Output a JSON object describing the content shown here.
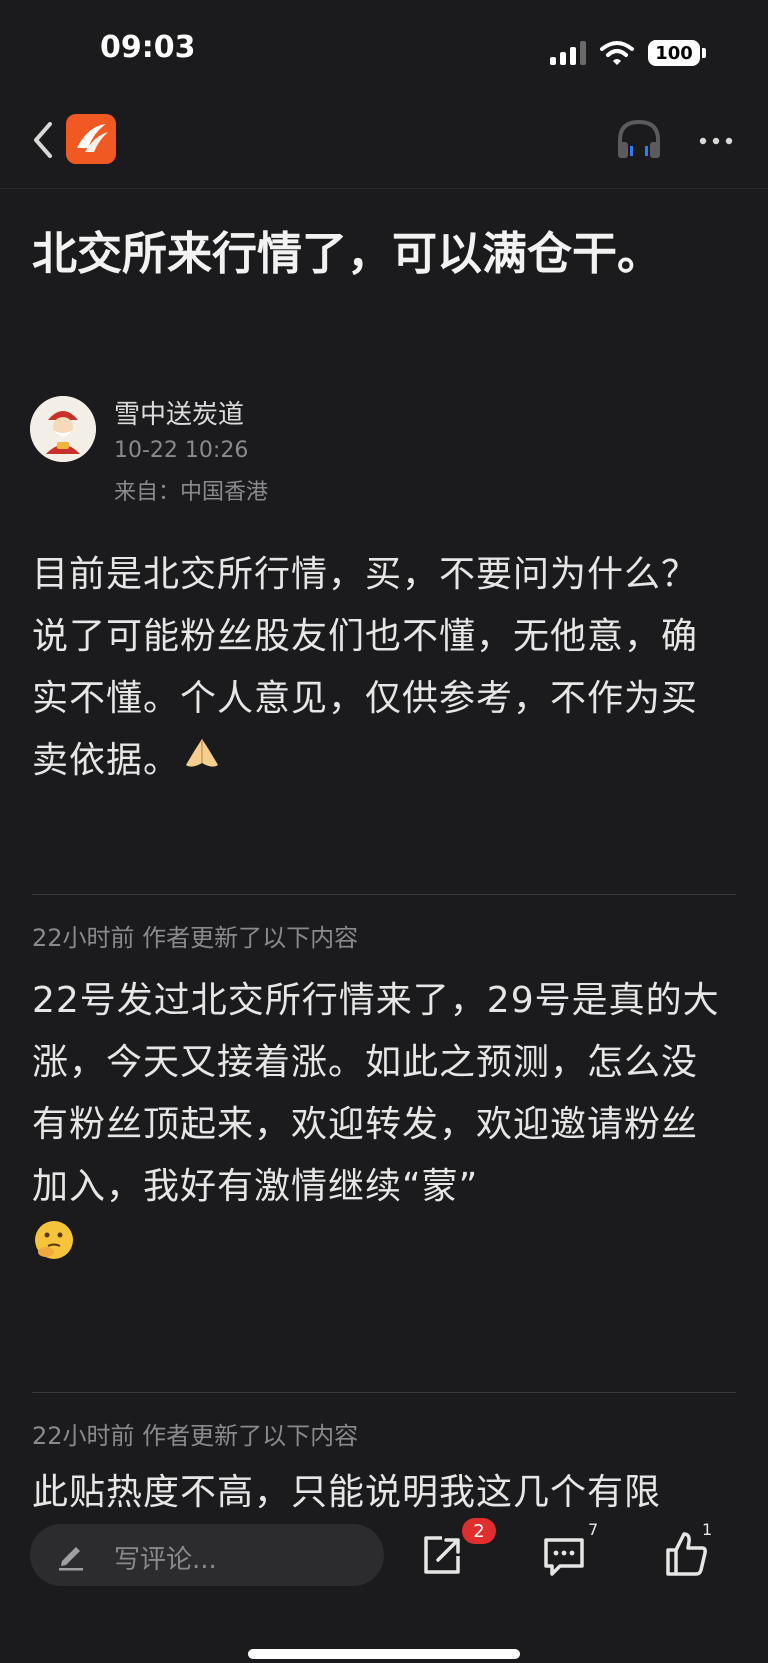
{
  "status_bar": {
    "time": "09:03",
    "battery": "100"
  },
  "nav": {
    "back_icon": "chevron-left-icon",
    "logo_icon": "app-logo-icon",
    "audio_icon": "headphone-icon",
    "more_icon": "more-dots-icon"
  },
  "post": {
    "title": "北交所来行情了，可以满仓干。",
    "author": "雪中送炭道",
    "time": "10-22 10:26",
    "origin": "来自：中国香港",
    "paragraph1": "目前是北交所行情，买，不要问为什么？说了可能粉丝股友们也不懂，无他意，确实不懂。个人意见，仅供参考，不作为买卖依据。",
    "emoji1": "pray-icon",
    "update1_label": "22小时前 作者更新了以下内容",
    "paragraph2": "22号发过北交所行情来了，29号是真的大涨，今天又接着涨。如此之预测，怎么没有粉丝顶起来，欢迎转发，欢迎邀请粉丝加入，我好有激情继续“蒙”",
    "emoji2": "thinking-face-icon",
    "update2_label": "22小时前 作者更新了以下内容",
    "paragraph3_partial": "此贴热度不高，只能说明我这几个有限"
  },
  "bottom_bar": {
    "comment_placeholder": "写评论...",
    "share_badge": "2",
    "comments_count": "7",
    "likes_count": "1"
  },
  "colors": {
    "background": "#1b1b1d",
    "brand": "#f05a22",
    "badge": "#e02e2e"
  }
}
